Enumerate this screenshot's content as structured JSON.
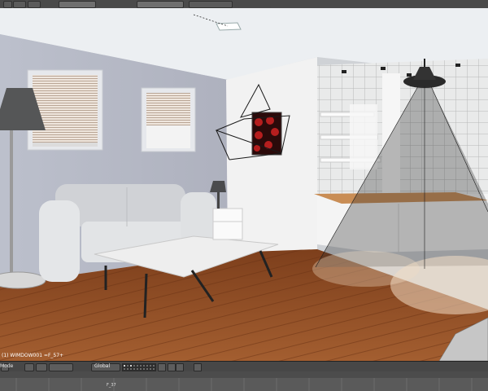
{
  "header": {
    "menu_icon": "blender-menu-icon",
    "scene_field": "",
    "layout_field": "",
    "render_engine": ""
  },
  "viewport": {
    "object_name": "(1) WIMDOW001 =F_57+",
    "scene_objects": [
      "sofa",
      "coffee-table",
      "floor-lamp",
      "table-lamp",
      "side-table",
      "window-left",
      "window-right",
      "picture-frame",
      "pendant-lamp",
      "kitchen-counter",
      "wall-shelves",
      "camera",
      "spotlight-cone",
      "area-light"
    ]
  },
  "view_header": {
    "mode": "Mode",
    "orientation": "Global",
    "layers_active": [
      0,
      2
    ]
  },
  "timeline": {
    "current_frame_label": "F_37"
  },
  "colors": {
    "ui_background": "#3a3a3a",
    "wall": "#b9bcc7",
    "floor": "#8a4a24",
    "ceiling": "#eceff2"
  }
}
